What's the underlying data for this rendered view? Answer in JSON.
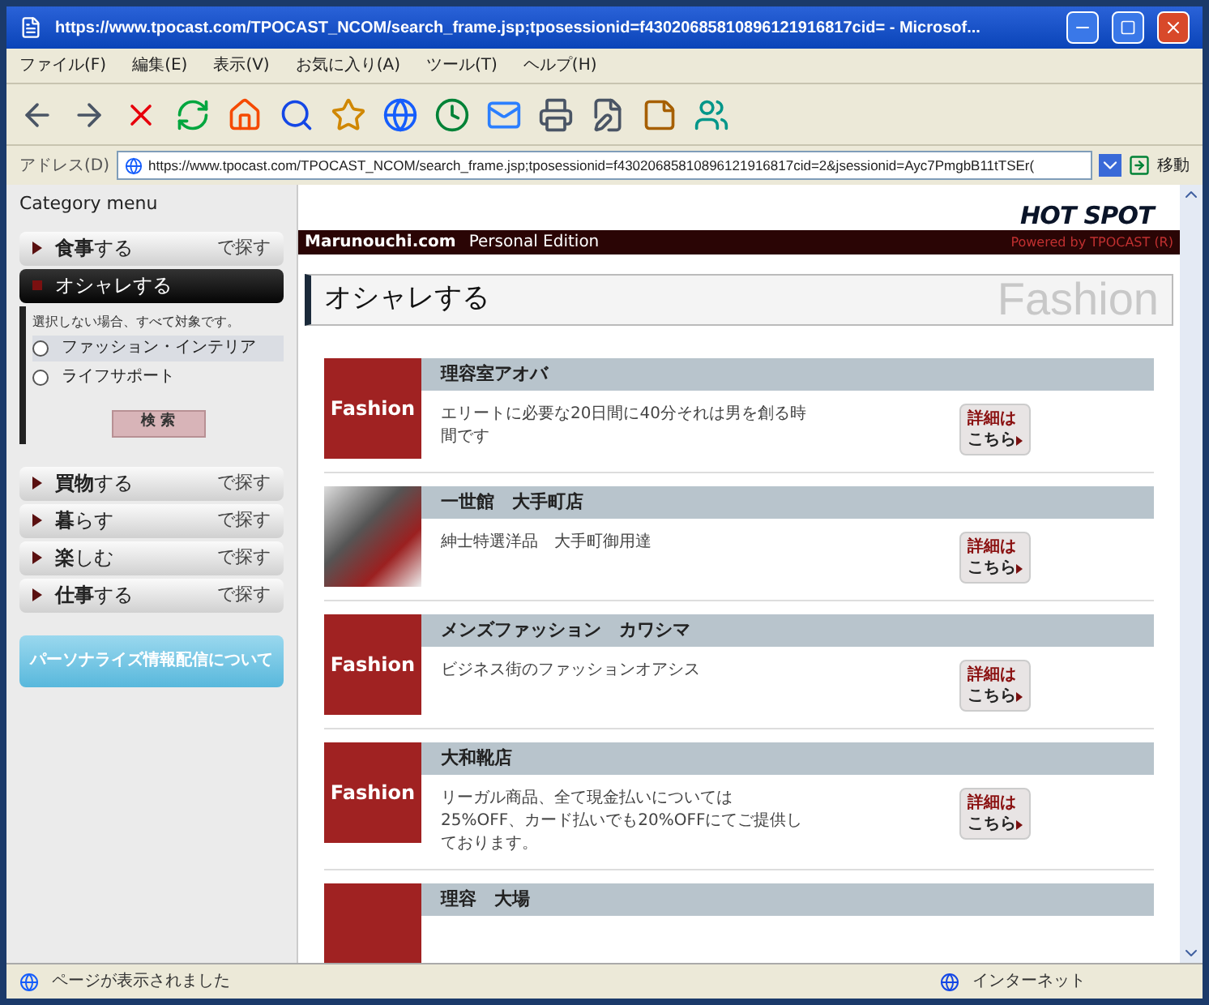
{
  "window": {
    "title": "https://www.tpocast.com/TPOCAST_NCOM/search_frame.jsp;tposessionid=f43020685810896121916817cid= - Microsof..."
  },
  "menu": [
    "ファイル(F)",
    "編集(E)",
    "表示(V)",
    "お気に入り(A)",
    "ツール(T)",
    "ヘルプ(H)"
  ],
  "address_bar": {
    "label": "アドレス(D)",
    "value": "https://www.tpocast.com/TPOCAST_NCOM/search_frame.jsp;tposessionid=f43020685810896121916817cid=2&jsessionid=Ayc7PmgbB11tTSEr(",
    "go": "移動"
  },
  "sidebar": {
    "title": "Category menu",
    "categories": [
      {
        "label": "**食事**する",
        "suffix": "で探す",
        "expanded": false
      },
      {
        "label": "オシャレする",
        "expanded": true,
        "note": "選択しない場合、すべて対象です。",
        "options": [
          {
            "label": "ファッション・インテリア",
            "checked": false,
            "highlighted": true
          },
          {
            "label": "ライフサポート",
            "checked": false,
            "highlighted": false
          }
        ],
        "search_button": "検 索"
      },
      {
        "label": "**買物**する",
        "suffix": "で探す",
        "expanded": false
      },
      {
        "label": "**暮**らす",
        "suffix": "で探す",
        "expanded": false
      },
      {
        "label": "**楽**しむ",
        "suffix": "で探す",
        "expanded": false
      },
      {
        "label": "**仕事**する",
        "suffix": "で探す",
        "expanded": false
      }
    ],
    "personalize_button": "パーソナライズ情報配信について"
  },
  "header": {
    "logo": "HOT SPOT",
    "site": "Marunouchi.com",
    "edition": "Personal Edition",
    "powered": "Powered by TPOCAST (R)"
  },
  "page_title": {
    "text": "オシャレする",
    "watermark": "Fashion"
  },
  "listings": [
    {
      "kind": "banner",
      "thumb_label": "Fashion",
      "name": "理容室アオバ",
      "description": "エリートに必要な20日間に40分それは男を創る時間です",
      "details": "詳細は",
      "details_2": "こちら"
    },
    {
      "kind": "photo",
      "name": "一世館　大手町店",
      "description": "紳士特選洋品　大手町御用達",
      "details": "詳細は",
      "details_2": "こちら"
    },
    {
      "kind": "banner",
      "thumb_label": "Fashion",
      "name": "メンズファッション　カワシマ",
      "description": "ビジネス街のファッションオアシス",
      "details": "詳細は",
      "details_2": "こちら"
    },
    {
      "kind": "banner",
      "thumb_label": "Fashion",
      "name": "大和靴店",
      "description": "リーガル商品、全て現金払いについては25%OFF、カード払いでも20%OFFにてご提供しております。",
      "details": "詳細は",
      "details_2": "こちら"
    },
    {
      "kind": "banner",
      "name": "理容　大場"
    }
  ],
  "status_bar": {
    "text": "ページが表示されました",
    "zone": "インターネット"
  }
}
